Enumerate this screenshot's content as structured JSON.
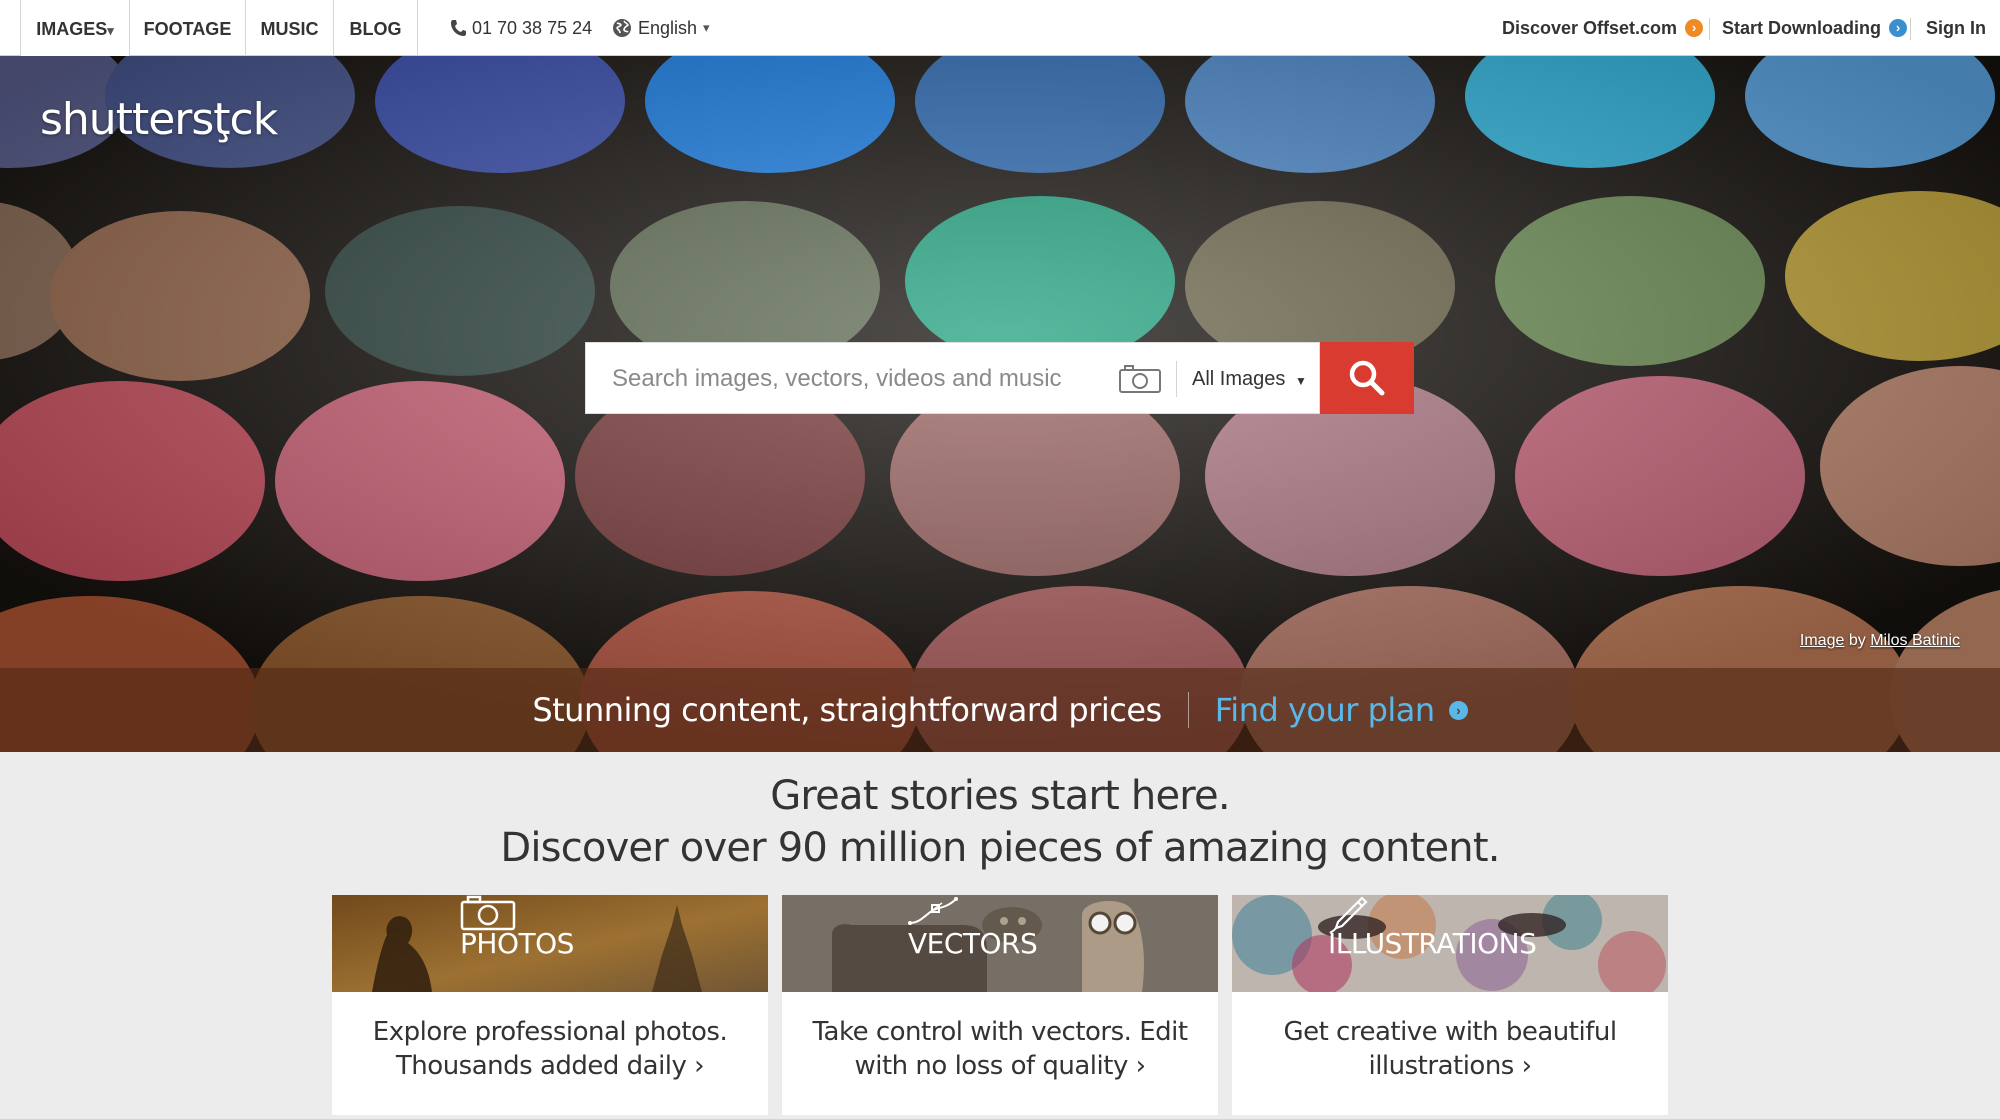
{
  "nav": {
    "tabs": [
      {
        "label": "IMAGES"
      },
      {
        "label": "FOOTAGE"
      },
      {
        "label": "MUSIC"
      },
      {
        "label": "BLOG"
      }
    ],
    "images_caret": "▾",
    "phone": "01 70 38 75 24",
    "language": "English",
    "language_caret": "▾",
    "offset_link": "Discover Offset.com",
    "download_link": "Start Downloading",
    "signin": "Sign In",
    "colors": {
      "offset_accent": "#f08a24",
      "download_accent": "#3a8fcf"
    }
  },
  "hero": {
    "logo": "shuttersţck",
    "search": {
      "placeholder": "Search images, vectors, videos and music",
      "category": "All Images",
      "button_icon": "search-icon"
    },
    "credit": {
      "image_link": "Image",
      "by": "by",
      "author_link": "Milos Batinic"
    },
    "banner": {
      "tagline": "Stunning content, straightforward prices",
      "cta": "Find your plan"
    },
    "colors": {
      "search_button": "#d93b31",
      "cta": "#59b8e8"
    }
  },
  "headline": {
    "line1": "Great stories start here.",
    "line2": "Discover over 90 million pieces of amazing content."
  },
  "cards": [
    {
      "title": "PHOTOS",
      "icon": "camera-icon",
      "line1": "Explore professional photos.",
      "line2": "Thousands added daily ›"
    },
    {
      "title": "VECTORS",
      "icon": "vector-pen-icon",
      "line1": "Take control with vectors. Edit",
      "line2": "with no loss of quality ›"
    },
    {
      "title": "ILLUSTRATIONS",
      "icon": "brush-icon",
      "line1": "Get creative with beautiful",
      "line2": "illustrations ›"
    }
  ]
}
